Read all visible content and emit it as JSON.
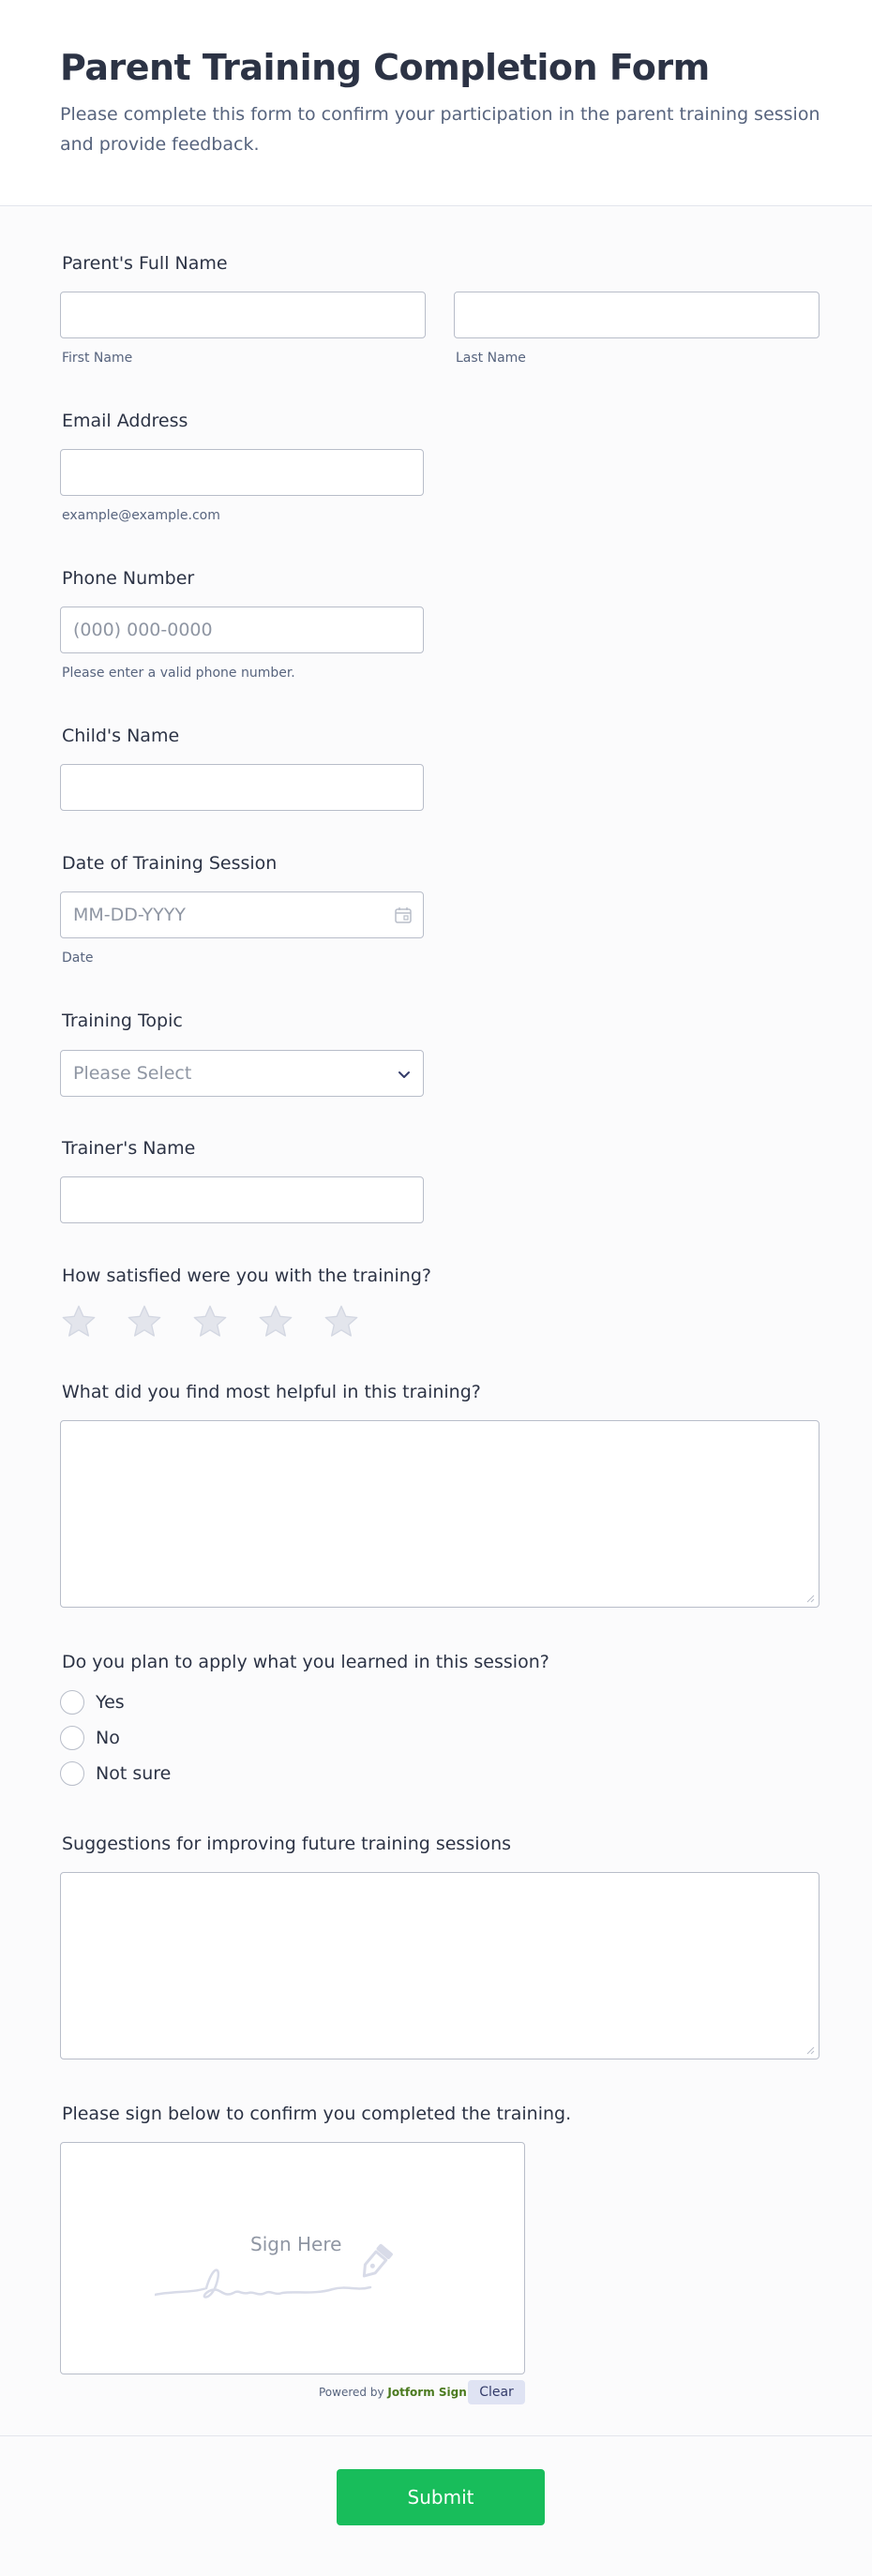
{
  "header": {
    "title": "Parent Training Completion Form",
    "description": "Please complete this form to confirm your participation in the parent training session and provide feedback."
  },
  "fields": {
    "full_name": {
      "label": "Parent's Full Name",
      "first_sub": "First Name",
      "last_sub": "Last Name",
      "first_value": "",
      "last_value": ""
    },
    "email": {
      "label": "Email Address",
      "sub": "example@example.com",
      "value": ""
    },
    "phone": {
      "label": "Phone Number",
      "placeholder": "(000) 000-0000",
      "sub": "Please enter a valid phone number."
    },
    "child": {
      "label": "Child's Name",
      "value": ""
    },
    "date": {
      "label": "Date of Training Session",
      "placeholder": "MM-DD-YYYY",
      "sub": "Date"
    },
    "topic": {
      "label": "Training Topic",
      "selected": "Please Select"
    },
    "trainer": {
      "label": "Trainer's Name",
      "value": ""
    },
    "rating": {
      "label": "How satisfied were you with the training?",
      "max": 5,
      "value": 0
    },
    "helpful": {
      "label": "What did you find most helpful in this training?"
    },
    "apply": {
      "label": "Do you plan to apply what you learned in this session?",
      "options": [
        "Yes",
        "No",
        "Not sure"
      ]
    },
    "suggestions": {
      "label": "Suggestions for improving future training sessions"
    },
    "signature": {
      "label": "Please sign below to confirm you completed the training.",
      "placeholder": "Sign Here",
      "powered_prefix": "Powered by",
      "powered_brand": "Jotform Sign",
      "clear_label": "Clear"
    }
  },
  "submit_label": "Submit",
  "colors": {
    "accent": "#18bd5b",
    "text": "#2c3345",
    "muted": "#57647e",
    "border": "#b8bdc9",
    "star": "#e3e5ec",
    "brand": "#4b7a1f"
  }
}
